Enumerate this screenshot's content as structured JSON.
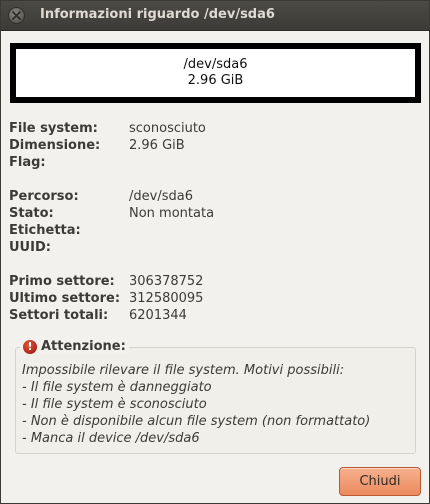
{
  "window": {
    "title": "Informazioni riguardo /dev/sda6"
  },
  "partition_box": {
    "device": "/dev/sda6",
    "size": "2.96 GiB"
  },
  "general": [
    {
      "label": "File system:",
      "value": "sconosciuto"
    },
    {
      "label": "Dimensione:",
      "value": "2.96 GiB"
    },
    {
      "label": "Flag:",
      "value": ""
    }
  ],
  "status": [
    {
      "label": "Percorso:",
      "value": "/dev/sda6"
    },
    {
      "label": "Stato:",
      "value": "Non montata"
    },
    {
      "label": "Etichetta:",
      "value": ""
    },
    {
      "label": "UUID:",
      "value": ""
    }
  ],
  "sectors": [
    {
      "label": "Primo settore:",
      "value": "306378752"
    },
    {
      "label": "Ultimo settore:",
      "value": "312580095"
    },
    {
      "label": "Settori totali:",
      "value": "6201344"
    }
  ],
  "warning": {
    "icon": "error-icon",
    "title": "Attenzione:",
    "lines": [
      "Impossibile rilevare il file system. Motivi possibili:",
      "- Il file system è danneggiato",
      "- Il file system è sconosciuto",
      "- Non è disponibile alcun file system (non formattato)",
      "- Manca il device /dev/sda6"
    ]
  },
  "buttons": {
    "close_label": "Chiudi"
  },
  "colors": {
    "titlebar": "#3c3b37",
    "accent_button": "#ec8a5f",
    "error": "#c0392b"
  }
}
